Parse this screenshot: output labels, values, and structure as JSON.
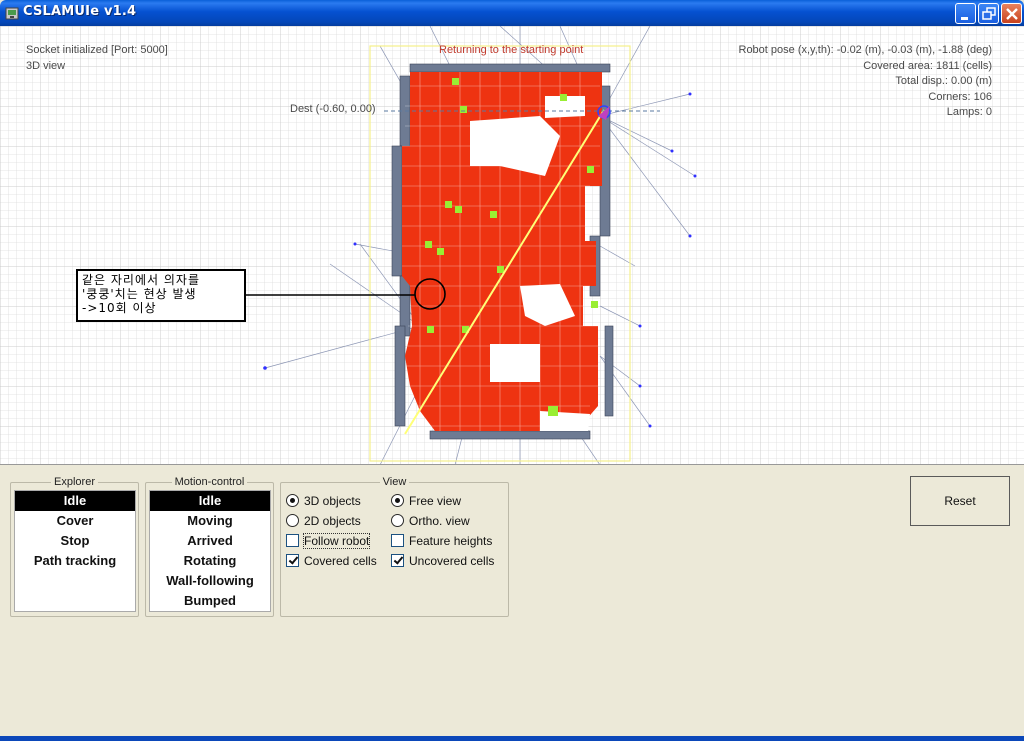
{
  "window": {
    "title": "CSLAMUIe v1.4"
  },
  "viewport": {
    "status_left": [
      "Socket initialized [Port: 5000]",
      "3D view"
    ],
    "status_center": "Returning to the starting point",
    "status_right": [
      "Robot pose (x,y,th): -0.02 (m), -0.03 (m), -1.88 (deg)",
      "Covered area: 1811 (cells)",
      "Total disp.: 0.00 (m)",
      "Corners: 106",
      "Lamps:   0"
    ],
    "dest_label": "Dest (-0.60, 0.00)",
    "annotation_lines": [
      "같은 자리에서 의자를",
      "'쿵쿵'치는 현상 발생",
      "->10회 이상"
    ],
    "colors": {
      "covered": "#ee3311",
      "uncovered": "#99ee33",
      "obstacle": "#6e7b93",
      "grid": "#d8d8d8",
      "path": "#ffff66"
    }
  },
  "explorer": {
    "legend": "Explorer",
    "items": [
      "Idle",
      "Cover",
      "Stop",
      "Path tracking"
    ],
    "selected": 0
  },
  "motion_control": {
    "legend": "Motion-control",
    "items": [
      "Idle",
      "Moving",
      "Arrived",
      "Rotating",
      "Wall-following",
      "Bumped"
    ],
    "selected": 0
  },
  "view": {
    "legend": "View",
    "options": {
      "objects_3d": {
        "label": "3D objects",
        "checked": true
      },
      "objects_2d": {
        "label": "2D objects",
        "checked": false
      },
      "follow_robot": {
        "label": "Follow robot",
        "checked": false
      },
      "covered_cells": {
        "label": "Covered cells",
        "checked": true
      },
      "free_view": {
        "label": "Free view",
        "checked": true
      },
      "ortho_view": {
        "label": "Ortho. view",
        "checked": false
      },
      "feature_heights": {
        "label": "Feature heights",
        "checked": false
      },
      "uncovered_cells": {
        "label": "Uncovered cells",
        "checked": true
      }
    }
  },
  "reset_label": "Reset"
}
